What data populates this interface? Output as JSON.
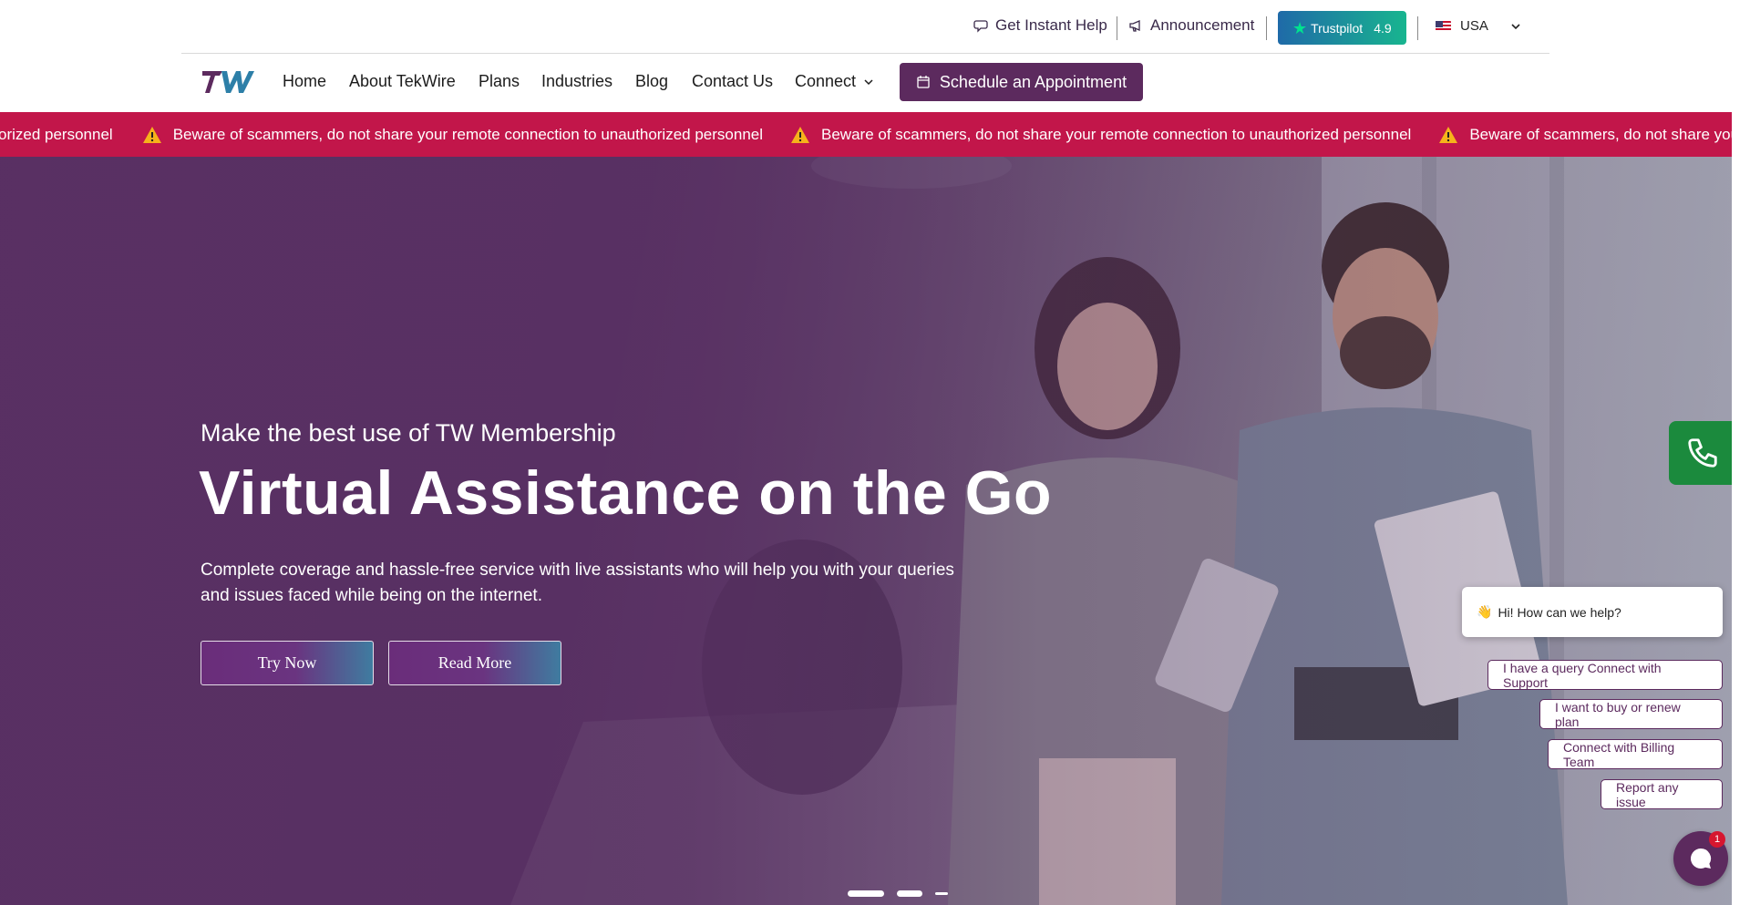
{
  "topbar": {
    "instant_help": "Get Instant Help",
    "announcement": "Announcement",
    "trustpilot_label": "Trustpilot",
    "trustpilot_score": "4.9",
    "country": "USA"
  },
  "nav": {
    "items": [
      "Home",
      "About TekWire",
      "Plans",
      "Industries",
      "Blog",
      "Contact Us",
      "Connect"
    ],
    "schedule_label": "Schedule an Appointment"
  },
  "warning": {
    "leading_fragment": "orized personnel",
    "message": "Beware of scammers, do not share your remote connection to unauthorized personnel"
  },
  "hero": {
    "subtitle": "Make the best use of TW Membership",
    "title": "Virtual Assistance on the Go",
    "description": "Complete coverage and hassle-free service with live assistants who will help you with your queries and issues faced while being on the internet.",
    "try_now": "Try Now",
    "read_more": "Read More",
    "slides_total": 3,
    "active_slide": 1
  },
  "chat": {
    "greeting_emoji": "👋",
    "greeting": "Hi! How can we help?",
    "options": [
      "I have a query Connect with Support",
      "I want to buy or renew plan",
      "Connect with Billing Team",
      "Report any issue"
    ],
    "unread_count": "1"
  },
  "colors": {
    "brand_purple": "#5c2a5e",
    "warning_red": "#c2164a",
    "phone_green": "#1b8a3d"
  }
}
